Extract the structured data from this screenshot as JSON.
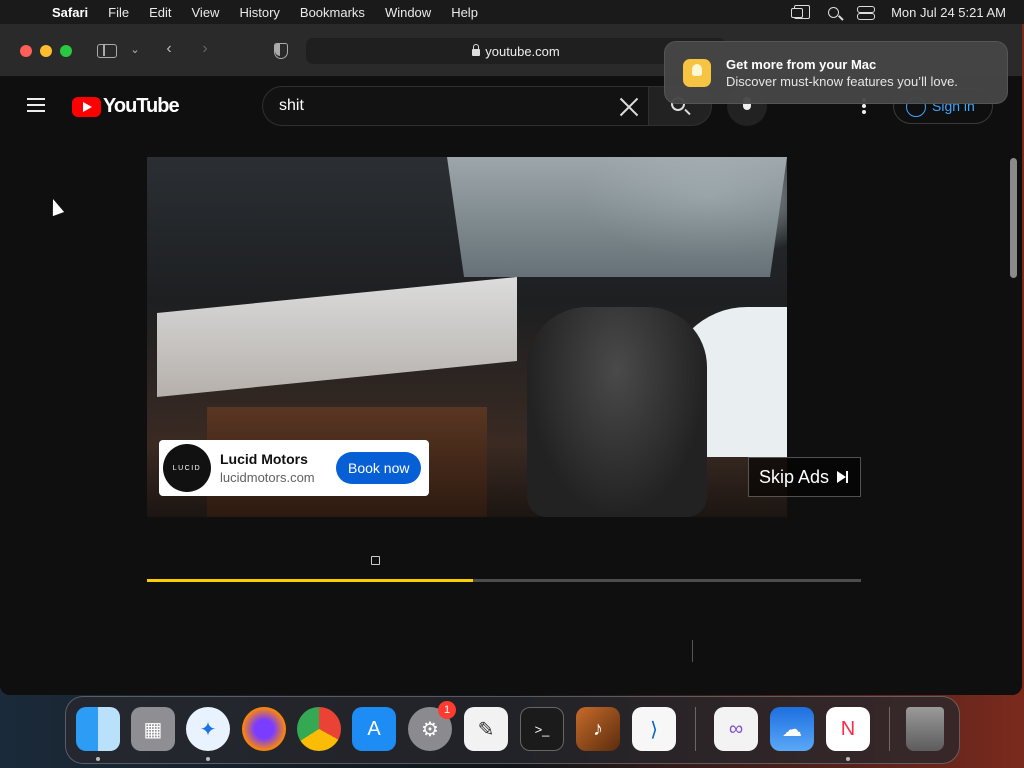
{
  "menubar": {
    "apple_icon": "apple-logo-icon",
    "items": [
      "Safari",
      "File",
      "Edit",
      "View",
      "History",
      "Bookmarks",
      "Window",
      "Help"
    ],
    "clock": "Mon Jul 24  5:21 AM"
  },
  "safari": {
    "url": "youtube.com"
  },
  "youtube": {
    "logo_text": "YouTube",
    "search_value": "shit",
    "signin_label": "Sign in",
    "ad": {
      "logo_text": "LUCID",
      "title": "Lucid Motors",
      "domain": "lucidmotors.com",
      "cta": "Book now"
    },
    "skip_label": "Skip Ads",
    "progress_percent": 45.6
  },
  "notification": {
    "title": "Get more from your Mac",
    "body": "Discover must-know features you’ll love."
  },
  "dock": {
    "badge_count": "1"
  },
  "colors": {
    "youtube_red": "#ff0000",
    "progress_ad": "#ffcc00",
    "cta_blue": "#065fd4",
    "signin_blue": "#3ea6ff"
  }
}
